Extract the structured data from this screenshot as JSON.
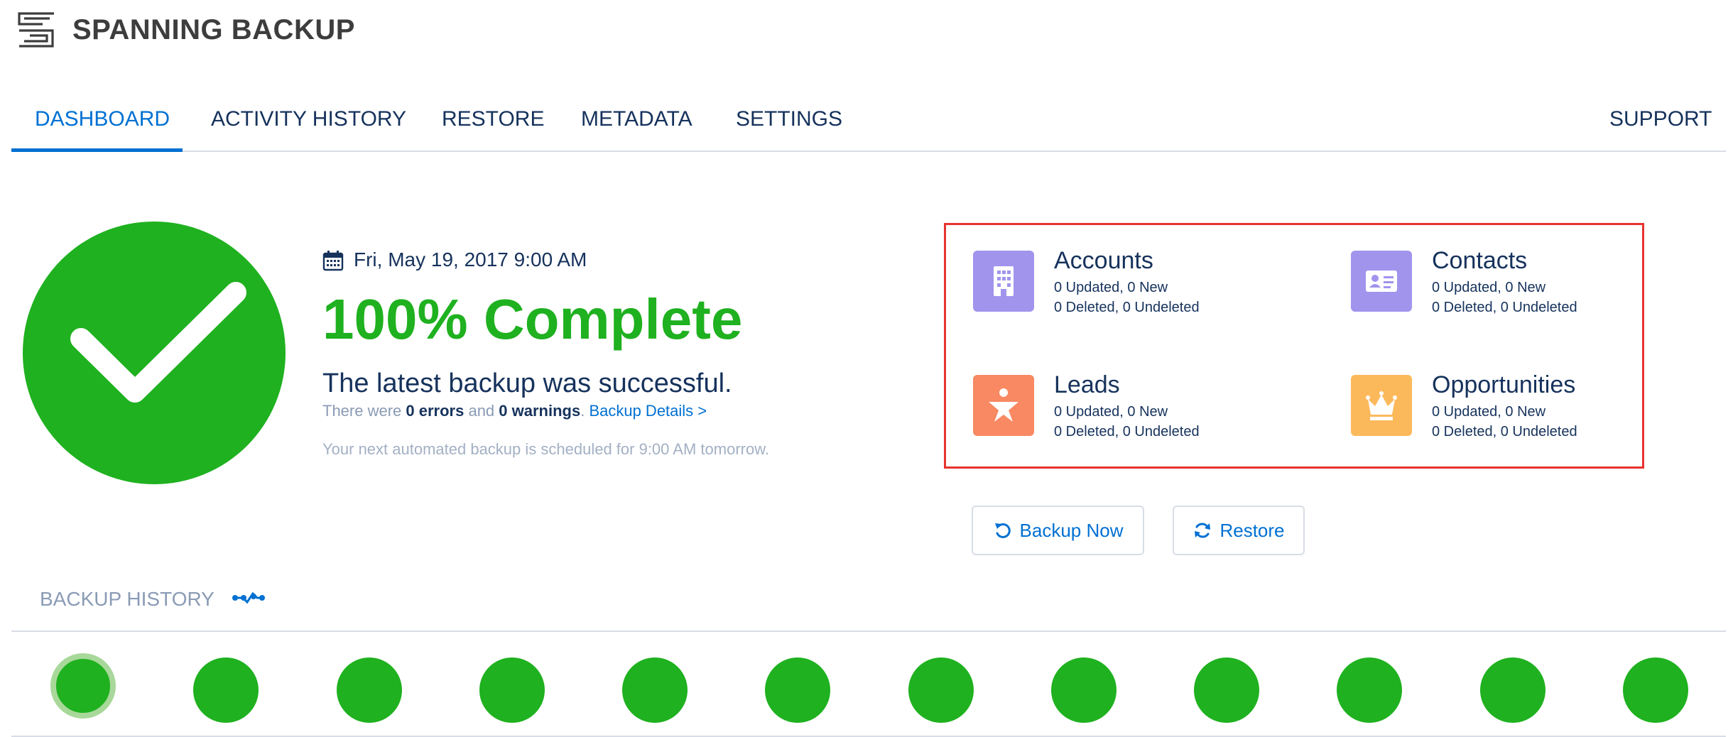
{
  "app": {
    "title": "SPANNING BACKUP"
  },
  "nav": {
    "items": [
      {
        "label": "DASHBOARD",
        "active": true
      },
      {
        "label": "ACTIVITY HISTORY",
        "active": false
      },
      {
        "label": "RESTORE",
        "active": false
      },
      {
        "label": "METADATA",
        "active": false
      },
      {
        "label": "SETTINGS",
        "active": false
      }
    ],
    "support": "SUPPORT"
  },
  "status": {
    "date": "Fri, May 19, 2017 9:00 AM",
    "percent": "100% Complete",
    "message": "The latest backup was successful.",
    "errors_prefix": "There were ",
    "errors": "0 errors",
    "and": " and ",
    "warnings": "0 warnings",
    "period": ". ",
    "details_link": "Backup Details >",
    "next": "Your next automated backup is scheduled for 9:00 AM tomorrow."
  },
  "objects": [
    {
      "name": "Accounts",
      "line1": "0 Updated, 0 New",
      "line2": "0 Deleted, 0 Undeleted",
      "icon": "building-icon",
      "color": "#a094ed"
    },
    {
      "name": "Contacts",
      "line1": "0 Updated, 0 New",
      "line2": "0 Deleted, 0 Undeleted",
      "icon": "contact-card-icon",
      "color": "#a094ed"
    },
    {
      "name": "Leads",
      "line1": "0 Updated, 0 New",
      "line2": "0 Deleted, 0 Undeleted",
      "icon": "lead-star-icon",
      "color": "#f88962"
    },
    {
      "name": "Opportunities",
      "line1": "0 Updated, 0 New",
      "line2": "0 Deleted, 0 Undeleted",
      "icon": "crown-icon",
      "color": "#fcb95b"
    }
  ],
  "buttons": {
    "backup_now": "Backup Now",
    "restore": "Restore"
  },
  "history": {
    "label": "BACKUP HISTORY",
    "dot_count": 12,
    "selected_index": 0
  },
  "colors": {
    "accent": "#0070d2",
    "success": "#1fb11f",
    "text": "#16325c",
    "highlight_border": "#e8332e"
  }
}
